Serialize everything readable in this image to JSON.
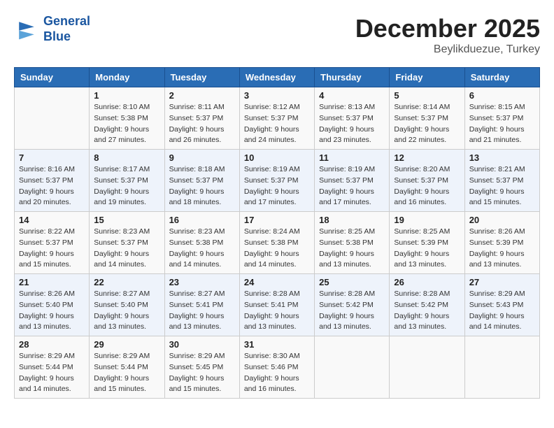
{
  "logo": {
    "line1": "General",
    "line2": "Blue"
  },
  "title": "December 2025",
  "location": "Beylikduezue, Turkey",
  "weekdays": [
    "Sunday",
    "Monday",
    "Tuesday",
    "Wednesday",
    "Thursday",
    "Friday",
    "Saturday"
  ],
  "weeks": [
    [
      {
        "day": "",
        "info": ""
      },
      {
        "day": "1",
        "info": "Sunrise: 8:10 AM\nSunset: 5:38 PM\nDaylight: 9 hours\nand 27 minutes."
      },
      {
        "day": "2",
        "info": "Sunrise: 8:11 AM\nSunset: 5:37 PM\nDaylight: 9 hours\nand 26 minutes."
      },
      {
        "day": "3",
        "info": "Sunrise: 8:12 AM\nSunset: 5:37 PM\nDaylight: 9 hours\nand 24 minutes."
      },
      {
        "day": "4",
        "info": "Sunrise: 8:13 AM\nSunset: 5:37 PM\nDaylight: 9 hours\nand 23 minutes."
      },
      {
        "day": "5",
        "info": "Sunrise: 8:14 AM\nSunset: 5:37 PM\nDaylight: 9 hours\nand 22 minutes."
      },
      {
        "day": "6",
        "info": "Sunrise: 8:15 AM\nSunset: 5:37 PM\nDaylight: 9 hours\nand 21 minutes."
      }
    ],
    [
      {
        "day": "7",
        "info": "Sunrise: 8:16 AM\nSunset: 5:37 PM\nDaylight: 9 hours\nand 20 minutes."
      },
      {
        "day": "8",
        "info": "Sunrise: 8:17 AM\nSunset: 5:37 PM\nDaylight: 9 hours\nand 19 minutes."
      },
      {
        "day": "9",
        "info": "Sunrise: 8:18 AM\nSunset: 5:37 PM\nDaylight: 9 hours\nand 18 minutes."
      },
      {
        "day": "10",
        "info": "Sunrise: 8:19 AM\nSunset: 5:37 PM\nDaylight: 9 hours\nand 17 minutes."
      },
      {
        "day": "11",
        "info": "Sunrise: 8:19 AM\nSunset: 5:37 PM\nDaylight: 9 hours\nand 17 minutes."
      },
      {
        "day": "12",
        "info": "Sunrise: 8:20 AM\nSunset: 5:37 PM\nDaylight: 9 hours\nand 16 minutes."
      },
      {
        "day": "13",
        "info": "Sunrise: 8:21 AM\nSunset: 5:37 PM\nDaylight: 9 hours\nand 15 minutes."
      }
    ],
    [
      {
        "day": "14",
        "info": "Sunrise: 8:22 AM\nSunset: 5:37 PM\nDaylight: 9 hours\nand 15 minutes."
      },
      {
        "day": "15",
        "info": "Sunrise: 8:23 AM\nSunset: 5:37 PM\nDaylight: 9 hours\nand 14 minutes."
      },
      {
        "day": "16",
        "info": "Sunrise: 8:23 AM\nSunset: 5:38 PM\nDaylight: 9 hours\nand 14 minutes."
      },
      {
        "day": "17",
        "info": "Sunrise: 8:24 AM\nSunset: 5:38 PM\nDaylight: 9 hours\nand 14 minutes."
      },
      {
        "day": "18",
        "info": "Sunrise: 8:25 AM\nSunset: 5:38 PM\nDaylight: 9 hours\nand 13 minutes."
      },
      {
        "day": "19",
        "info": "Sunrise: 8:25 AM\nSunset: 5:39 PM\nDaylight: 9 hours\nand 13 minutes."
      },
      {
        "day": "20",
        "info": "Sunrise: 8:26 AM\nSunset: 5:39 PM\nDaylight: 9 hours\nand 13 minutes."
      }
    ],
    [
      {
        "day": "21",
        "info": "Sunrise: 8:26 AM\nSunset: 5:40 PM\nDaylight: 9 hours\nand 13 minutes."
      },
      {
        "day": "22",
        "info": "Sunrise: 8:27 AM\nSunset: 5:40 PM\nDaylight: 9 hours\nand 13 minutes."
      },
      {
        "day": "23",
        "info": "Sunrise: 8:27 AM\nSunset: 5:41 PM\nDaylight: 9 hours\nand 13 minutes."
      },
      {
        "day": "24",
        "info": "Sunrise: 8:28 AM\nSunset: 5:41 PM\nDaylight: 9 hours\nand 13 minutes."
      },
      {
        "day": "25",
        "info": "Sunrise: 8:28 AM\nSunset: 5:42 PM\nDaylight: 9 hours\nand 13 minutes."
      },
      {
        "day": "26",
        "info": "Sunrise: 8:28 AM\nSunset: 5:42 PM\nDaylight: 9 hours\nand 13 minutes."
      },
      {
        "day": "27",
        "info": "Sunrise: 8:29 AM\nSunset: 5:43 PM\nDaylight: 9 hours\nand 14 minutes."
      }
    ],
    [
      {
        "day": "28",
        "info": "Sunrise: 8:29 AM\nSunset: 5:44 PM\nDaylight: 9 hours\nand 14 minutes."
      },
      {
        "day": "29",
        "info": "Sunrise: 8:29 AM\nSunset: 5:44 PM\nDaylight: 9 hours\nand 15 minutes."
      },
      {
        "day": "30",
        "info": "Sunrise: 8:29 AM\nSunset: 5:45 PM\nDaylight: 9 hours\nand 15 minutes."
      },
      {
        "day": "31",
        "info": "Sunrise: 8:30 AM\nSunset: 5:46 PM\nDaylight: 9 hours\nand 16 minutes."
      },
      {
        "day": "",
        "info": ""
      },
      {
        "day": "",
        "info": ""
      },
      {
        "day": "",
        "info": ""
      }
    ]
  ]
}
